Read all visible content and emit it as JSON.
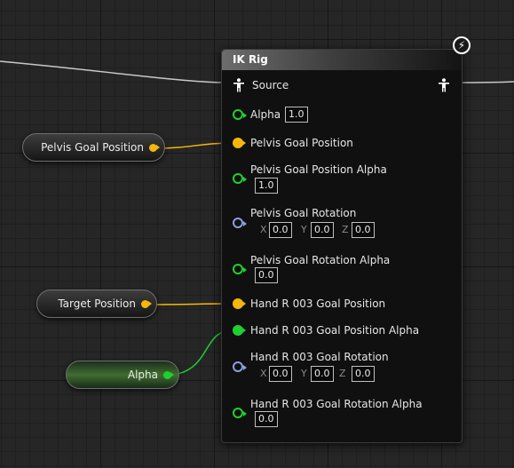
{
  "left_nodes": {
    "pelvis_goal_position": "Pelvis Goal Position",
    "target_position": "Target Position",
    "alpha": "Alpha"
  },
  "ik_node": {
    "title": "IK Rig",
    "source_label": "Source",
    "alpha_label": "Alpha",
    "alpha_value": "1.0",
    "pelvis_goal_position_label": "Pelvis Goal Position",
    "pelvis_goal_position_alpha_label": "Pelvis Goal Position Alpha",
    "pelvis_goal_position_alpha_value": "1.0",
    "pelvis_goal_rotation_label": "Pelvis Goal Rotation",
    "pelvis_goal_rotation": {
      "x_label": "X",
      "x": "0.0",
      "y_label": "Y",
      "y": "0.0",
      "z_label": "Z",
      "z": "0.0"
    },
    "pelvis_goal_rotation_alpha_label": "Pelvis Goal Rotation Alpha",
    "pelvis_goal_rotation_alpha_value": "0.0",
    "hand_goal_position_label": "Hand R 003 Goal Position",
    "hand_goal_position_alpha_label": "Hand R 003 Goal Position Alpha",
    "hand_goal_rotation_label": "Hand R 003 Goal Rotation",
    "hand_goal_rotation": {
      "x_label": "X",
      "x": "0.0",
      "y_label": "Y",
      "y": "0.0",
      "z_label": "Z",
      "z": "0.0"
    },
    "hand_goal_rotation_alpha_label": "Hand R 003 Goal Rotation Alpha",
    "hand_goal_rotation_alpha_value": "0.0"
  },
  "icons": [
    "skeleton-pose-icon",
    "lightning-icon"
  ],
  "colors": {
    "vector_pin": "#f5b80a",
    "float_pin": "#1fd12f",
    "rotator_pin": "#8a9fe6",
    "exec_wire": "#c8c8c8"
  }
}
